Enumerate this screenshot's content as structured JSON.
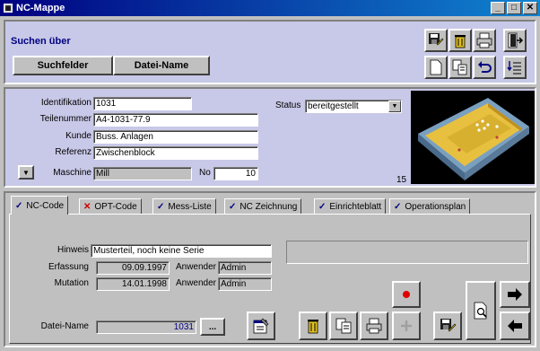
{
  "window": {
    "title": "NC-Mappe"
  },
  "search": {
    "label": "Suchen über",
    "btn_fields": "Suchfelder",
    "btn_filename": "Datei-Name"
  },
  "form": {
    "id_label": "Identifikation",
    "id_value": "1031",
    "part_label": "Teilenummer",
    "part_value": "A4-1031-77.9",
    "customer_label": "Kunde",
    "customer_value": "Buss. Anlagen",
    "ref_label": "Referenz",
    "ref_value": "Zwischenblock",
    "machine_label": "Maschine",
    "machine_value": "Mill",
    "no_label": "No",
    "no_value": "10",
    "status_label": "Status",
    "status_value": "bereitgestellt",
    "preview_number": "15"
  },
  "tabs": [
    {
      "mark": "✓",
      "label": "NC-Code"
    },
    {
      "mark": "✕",
      "label": "OPT-Code"
    },
    {
      "mark": "✓",
      "label": "Mess-Liste"
    },
    {
      "mark": "✓",
      "label": "NC Zeichnung"
    },
    {
      "mark": "✓",
      "label": "Einrichteblatt"
    },
    {
      "mark": "✓",
      "label": "Operationsplan"
    }
  ],
  "nc": {
    "hint_label": "Hinweis",
    "hint_value": "Musterteil, noch keine Serie",
    "entry_label": "Erfassung",
    "entry_date": "09.09.1997",
    "user_label": "Anwender",
    "entry_user": "Admin",
    "mutation_label": "Mutation",
    "mutation_date": "14.01.1998",
    "mutation_user": "Admin",
    "filename_label": "Datei-Name",
    "filename_value": "1031",
    "browse_label": "..."
  },
  "colors": {
    "panel": "#c8c8e8",
    "title_start": "#000080",
    "title_end": "#1084d0"
  }
}
